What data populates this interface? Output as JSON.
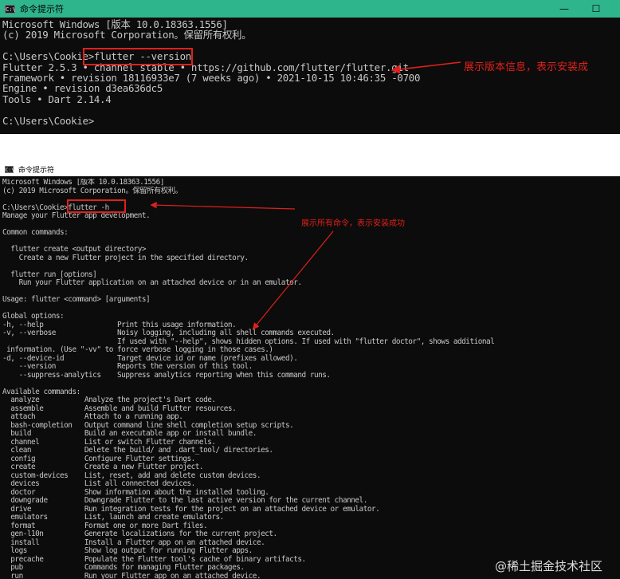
{
  "window1": {
    "title": "命令提示符",
    "icon": "C:\\",
    "controls": {
      "minimize": "—",
      "maximize": "☐"
    },
    "lines": [
      "Microsoft Windows [版本 10.0.18363.1556]",
      "(c) 2019 Microsoft Corporation。保留所有权利。",
      "",
      "C:\\Users\\Cookie>flutter --version",
      "Flutter 2.5.3 • channel stable • https://github.com/flutter/flutter.git",
      "Framework • revision 18116933e7 (7 weeks ago) • 2021-10-15 10:46:35 -0700",
      "Engine • revision d3ea636dc5",
      "Tools • Dart 2.14.4",
      "",
      "C:\\Users\\Cookie>"
    ],
    "annotation": "展示版本信息，表示安装成",
    "accent": "#2fb58c"
  },
  "window2": {
    "title": "命令提示符",
    "icon": "C:\\",
    "lines": [
      "Microsoft Windows [版本 10.0.18363.1556]",
      "(c) 2019 Microsoft Corporation。保留所有权利。",
      "",
      "C:\\Users\\Cookie>flutter -h",
      "Manage your Flutter app development.",
      "",
      "Common commands:",
      "",
      "  flutter create <output directory>",
      "    Create a new Flutter project in the specified directory.",
      "",
      "  flutter run [options]",
      "    Run your Flutter application on an attached device or in an emulator.",
      "",
      "Usage: flutter <command> [arguments]",
      "",
      "Global options:",
      "-h, --help                  Print this usage information.",
      "-v, --verbose               Noisy logging, including all shell commands executed.",
      "                            If used with \"--help\", shows hidden options. If used with \"flutter doctor\", shows additional",
      " information. (Use \"-vv\" to force verbose logging in those cases.)",
      "-d, --device-id             Target device id or name (prefixes allowed).",
      "    --version               Reports the version of this tool.",
      "    --suppress-analytics    Suppress analytics reporting when this command runs.",
      "",
      "Available commands:",
      "  analyze           Analyze the project's Dart code.",
      "  assemble          Assemble and build Flutter resources.",
      "  attach            Attach to a running app.",
      "  bash-completion   Output command line shell completion setup scripts.",
      "  build             Build an executable app or install bundle.",
      "  channel           List or switch Flutter channels.",
      "  clean             Delete the build/ and .dart_tool/ directories.",
      "  config            Configure Flutter settings.",
      "  create            Create a new Flutter project.",
      "  custom-devices    List, reset, add and delete custom devices.",
      "  devices           List all connected devices.",
      "  doctor            Show information about the installed tooling.",
      "  downgrade         Downgrade Flutter to the last active version for the current channel.",
      "  drive             Run integration tests for the project on an attached device or emulator.",
      "  emulators         List, launch and create emulators.",
      "  format            Format one or more Dart files.",
      "  gen-l10n          Generate localizations for the current project.",
      "  install           Install a Flutter app on an attached device.",
      "  logs              Show log output for running Flutter apps.",
      "  precache          Populate the Flutter tool's cache of binary artifacts.",
      "  pub               Commands for managing Flutter packages.",
      "  run               Run your Flutter app on an attached device."
    ],
    "annotation": "展示所有命令，表示安装成功"
  },
  "watermark": "@稀土掘金技术社区",
  "highlight_color": "#e0201c"
}
